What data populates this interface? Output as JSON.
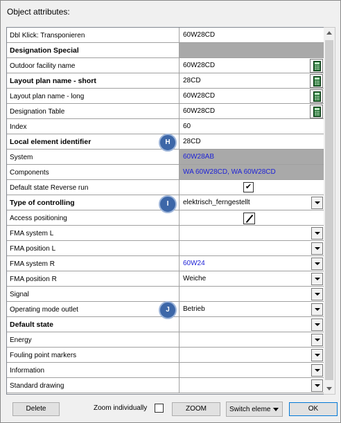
{
  "window": {
    "title": "Object attributes:"
  },
  "rows": [
    {
      "name": "Dbl Klick: Transponieren",
      "bold": false,
      "value": "60W28CD",
      "style": "",
      "control": ""
    },
    {
      "name": "Designation Special",
      "bold": true,
      "value": "",
      "style": "gray",
      "control": ""
    },
    {
      "name": "Outdoor facility name",
      "bold": false,
      "value": "60W28CD",
      "style": "",
      "control": "calc"
    },
    {
      "name": "Layout plan name - short",
      "bold": true,
      "value": "28CD",
      "style": "",
      "control": "calc"
    },
    {
      "name": "Layout plan name - long",
      "bold": false,
      "value": "60W28CD",
      "style": "",
      "control": "calc"
    },
    {
      "name": "Designation Table",
      "bold": false,
      "value": "60W28CD",
      "style": "",
      "control": "calc"
    },
    {
      "name": "Index",
      "bold": false,
      "value": "60",
      "style": "",
      "control": ""
    },
    {
      "name": "Local element identifier",
      "bold": true,
      "value": "28CD",
      "style": "",
      "control": ""
    },
    {
      "name": "System",
      "bold": false,
      "value": "60W28AB",
      "style": "gray-blue",
      "control": ""
    },
    {
      "name": "Components",
      "bold": false,
      "value": "WA 60W28CD, WA 60W28CD",
      "style": "gray-blue",
      "control": ""
    },
    {
      "name": "Default state Reverse run",
      "bold": false,
      "value": "✔",
      "style": "",
      "control": "check"
    },
    {
      "name": "Type of controlling",
      "bold": true,
      "value": "elektrisch_ferngestellt",
      "style": "",
      "control": "dropdown"
    },
    {
      "name": "Access positioning",
      "bold": false,
      "value": "",
      "style": "",
      "control": "pen"
    },
    {
      "name": "FMA system L",
      "bold": false,
      "value": "",
      "style": "",
      "control": "dropdown"
    },
    {
      "name": "FMA position L",
      "bold": false,
      "value": "",
      "style": "",
      "control": "dropdown"
    },
    {
      "name": "FMA system R",
      "bold": false,
      "value": "60W24",
      "style": "blue",
      "control": "dropdown"
    },
    {
      "name": "FMA position R",
      "bold": false,
      "value": "Weiche",
      "style": "",
      "control": "dropdown"
    },
    {
      "name": "Signal",
      "bold": false,
      "value": "",
      "style": "",
      "control": "dropdown"
    },
    {
      "name": "Operating mode outlet",
      "bold": false,
      "value": "Betrieb",
      "style": "",
      "control": "dropdown"
    },
    {
      "name": "Default state",
      "bold": true,
      "value": "",
      "style": "",
      "control": "dropdown"
    },
    {
      "name": "Energy",
      "bold": false,
      "value": "",
      "style": "",
      "control": "dropdown"
    },
    {
      "name": "Fouling point markers",
      "bold": false,
      "value": "",
      "style": "",
      "control": "dropdown"
    },
    {
      "name": "Information",
      "bold": false,
      "value": "",
      "style": "",
      "control": "dropdown"
    },
    {
      "name": "Standard drawing",
      "bold": false,
      "value": "",
      "style": "",
      "control": "dropdown"
    }
  ],
  "badges": {
    "h": "H",
    "i": "I",
    "j": "J"
  },
  "footer": {
    "delete_label": "Delete",
    "zoom_individually_label": "Zoom individually",
    "zoom_label": "ZOOM",
    "switch_label": "Switch elements",
    "ok_label": "OK"
  },
  "colors": {
    "link_blue": "#1e22d6",
    "gray_cell": "#a9a9a9",
    "badge": "#3d67a8"
  }
}
